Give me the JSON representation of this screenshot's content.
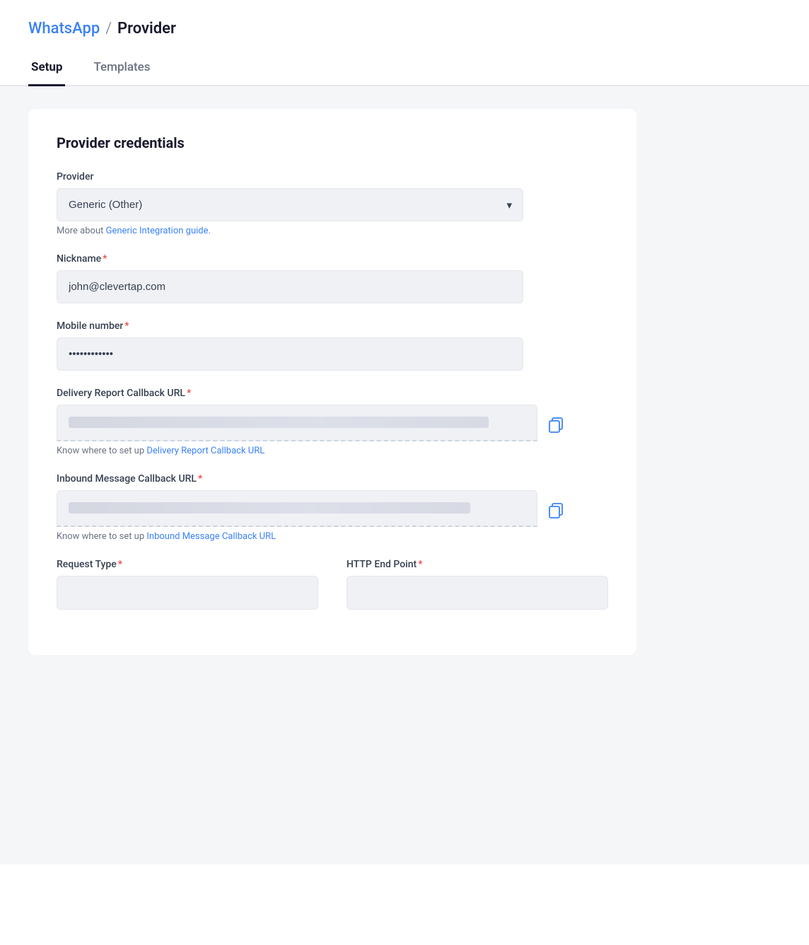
{
  "breadcrumb": {
    "link_label": "WhatsApp",
    "separator": "/",
    "current": "Provider"
  },
  "tabs": [
    {
      "id": "setup",
      "label": "Setup",
      "active": true
    },
    {
      "id": "templates",
      "label": "Templates",
      "active": false
    }
  ],
  "card": {
    "title": "Provider credentials",
    "fields": {
      "provider": {
        "label": "Provider",
        "value": "Generic (Other)",
        "required": false
      },
      "provider_helper": {
        "text": "More about ",
        "link_text": "Generic Integration guide.",
        "link_href": "#"
      },
      "nickname": {
        "label": "Nickname",
        "required": true,
        "value": "john@clevertap.com"
      },
      "mobile_number": {
        "label": "Mobile number",
        "required": true,
        "value": "••••••••••••"
      },
      "delivery_url": {
        "label": "Delivery Report Callback URL",
        "required": true,
        "helper_prefix": "Know where to set up ",
        "helper_link": "Delivery Report Callback URL"
      },
      "inbound_url": {
        "label": "Inbound Message Callback URL",
        "required": true,
        "helper_prefix": "Know where to set up ",
        "helper_link": "Inbound Message Callback URL"
      },
      "request_type": {
        "label": "Request Type",
        "required": true
      },
      "http_endpoint": {
        "label": "HTTP End Point",
        "required": true
      }
    }
  },
  "icons": {
    "copy": "⧉",
    "chevron_down": "▾"
  }
}
